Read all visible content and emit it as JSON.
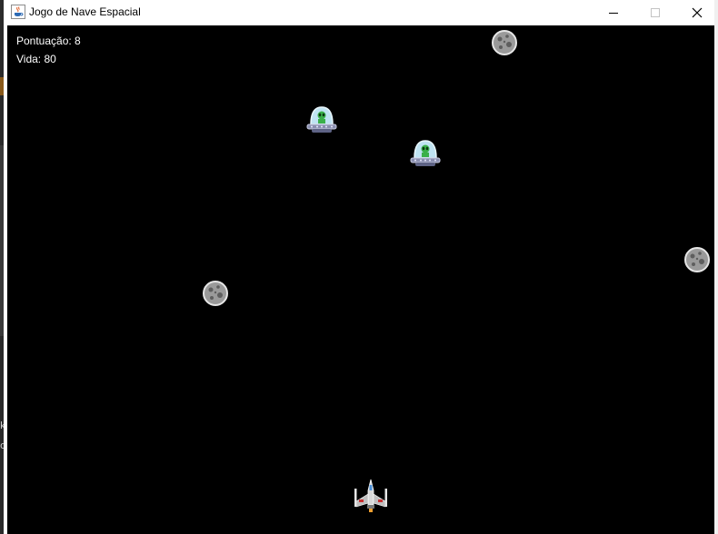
{
  "window": {
    "title": "Jogo de Nave Espacial",
    "app_icon": "java-cup-icon",
    "controls": [
      "minimize-icon",
      "maximize-icon",
      "close-icon"
    ]
  },
  "hud": {
    "score_label": "Pontuação: 8",
    "life_label": "Vida: 80"
  },
  "sprites": {
    "player": "player-spaceship-icon",
    "enemy": "ufo-alien-icon",
    "obstacle": "asteroid-icon"
  },
  "colors": {
    "game_background": "#000000",
    "hud_text": "#ffffff",
    "asteroid": "#9a9a9a",
    "ufo_dome": "#bfe3f2",
    "alien": "#3ab04a",
    "ufo_hull": "#8a8fb0"
  },
  "desktop_edge": {
    "letters": [
      "k",
      "d"
    ]
  }
}
